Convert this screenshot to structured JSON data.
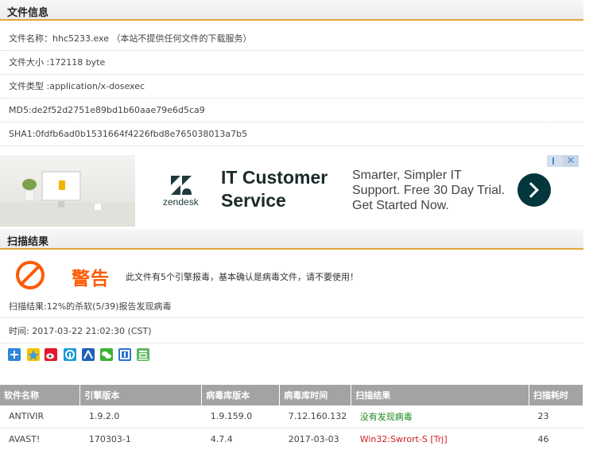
{
  "file_info": {
    "header": "文件信息",
    "rows": [
      "文件名称：hhc5233.exe （本站不提供任何文件的下载服务）",
      "文件大小 :172118 byte",
      "文件类型 :application/x-dosexec",
      "MD5:de2f52d2751e89bd1b60aae79e6d5ca9",
      "SHA1:0fdfb6ad0b1531664f4226fbd8e765038013a7b5"
    ]
  },
  "ad": {
    "brand": "zendesk",
    "title": "IT Customer Service",
    "body": "Smarter, Simpler IT Support. Free 30 Day Trial. Get Started Now.",
    "close_glyph": "✕",
    "accent_color": "#03363d"
  },
  "scan": {
    "header": "扫描结果",
    "warning_title": "警告",
    "warning_text": "此文件有5个引擎报毒，基本确认是病毒文件，请不要使用！",
    "summary": "扫描结果:12%的杀软(5/39)报告发现病毒",
    "time": "时间: 2017-03-22 21:02:30 (CST)",
    "share_icons": [
      "plus-share-icon",
      "qzone-star-icon",
      "weibo-icon",
      "paipai-icon",
      "renren-icon",
      "wechat-icon",
      "tieba-icon",
      "douban-icon"
    ]
  },
  "table": {
    "headers": [
      "软件名称",
      "引擎版本",
      "病毒库版本",
      "病毒库时间",
      "扫描结果",
      "扫描耗时"
    ],
    "rows": [
      [
        "ANTIVIR",
        "1.9.2.0",
        "1.9.159.0",
        "7.12.160.132",
        "没有发现病毒",
        "23"
      ],
      [
        "AVAST!",
        "170303-1",
        "4.7.4",
        "2017-03-03",
        "Win32:Swrort-S [Trj]",
        "46"
      ]
    ]
  }
}
